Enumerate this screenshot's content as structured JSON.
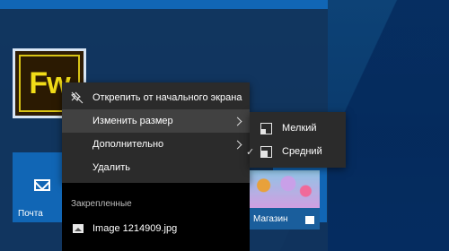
{
  "tiles": {
    "fireworks": {
      "logo_text": "Fw"
    },
    "mail": {
      "label": "Почта"
    },
    "store": {
      "label": "Магазин"
    }
  },
  "context_menu": {
    "items": [
      {
        "label": "Открепить от начального экрана",
        "icon": "unpin-icon",
        "has_submenu": false
      },
      {
        "label": "Изменить размер",
        "icon": "",
        "has_submenu": true,
        "highlighted": true
      },
      {
        "label": "Дополнительно",
        "icon": "",
        "has_submenu": true
      },
      {
        "label": "Удалить",
        "icon": "",
        "has_submenu": false
      }
    ]
  },
  "resize_submenu": {
    "items": [
      {
        "label": "Мелкий",
        "icon": "small-tile-icon",
        "checked": false
      },
      {
        "label": "Средний",
        "icon": "medium-tile-icon",
        "checked": true
      }
    ]
  },
  "jump_list": {
    "header": "Закрепленные",
    "items": [
      {
        "label": "Image 1214909.jpg",
        "icon": "image-file-icon"
      }
    ]
  },
  "colors": {
    "start_tile_blue": "#1166b5",
    "menu_bg": "#2b2b2b",
    "menu_highlight": "#414141",
    "fw_accent": "#f1dc18"
  }
}
